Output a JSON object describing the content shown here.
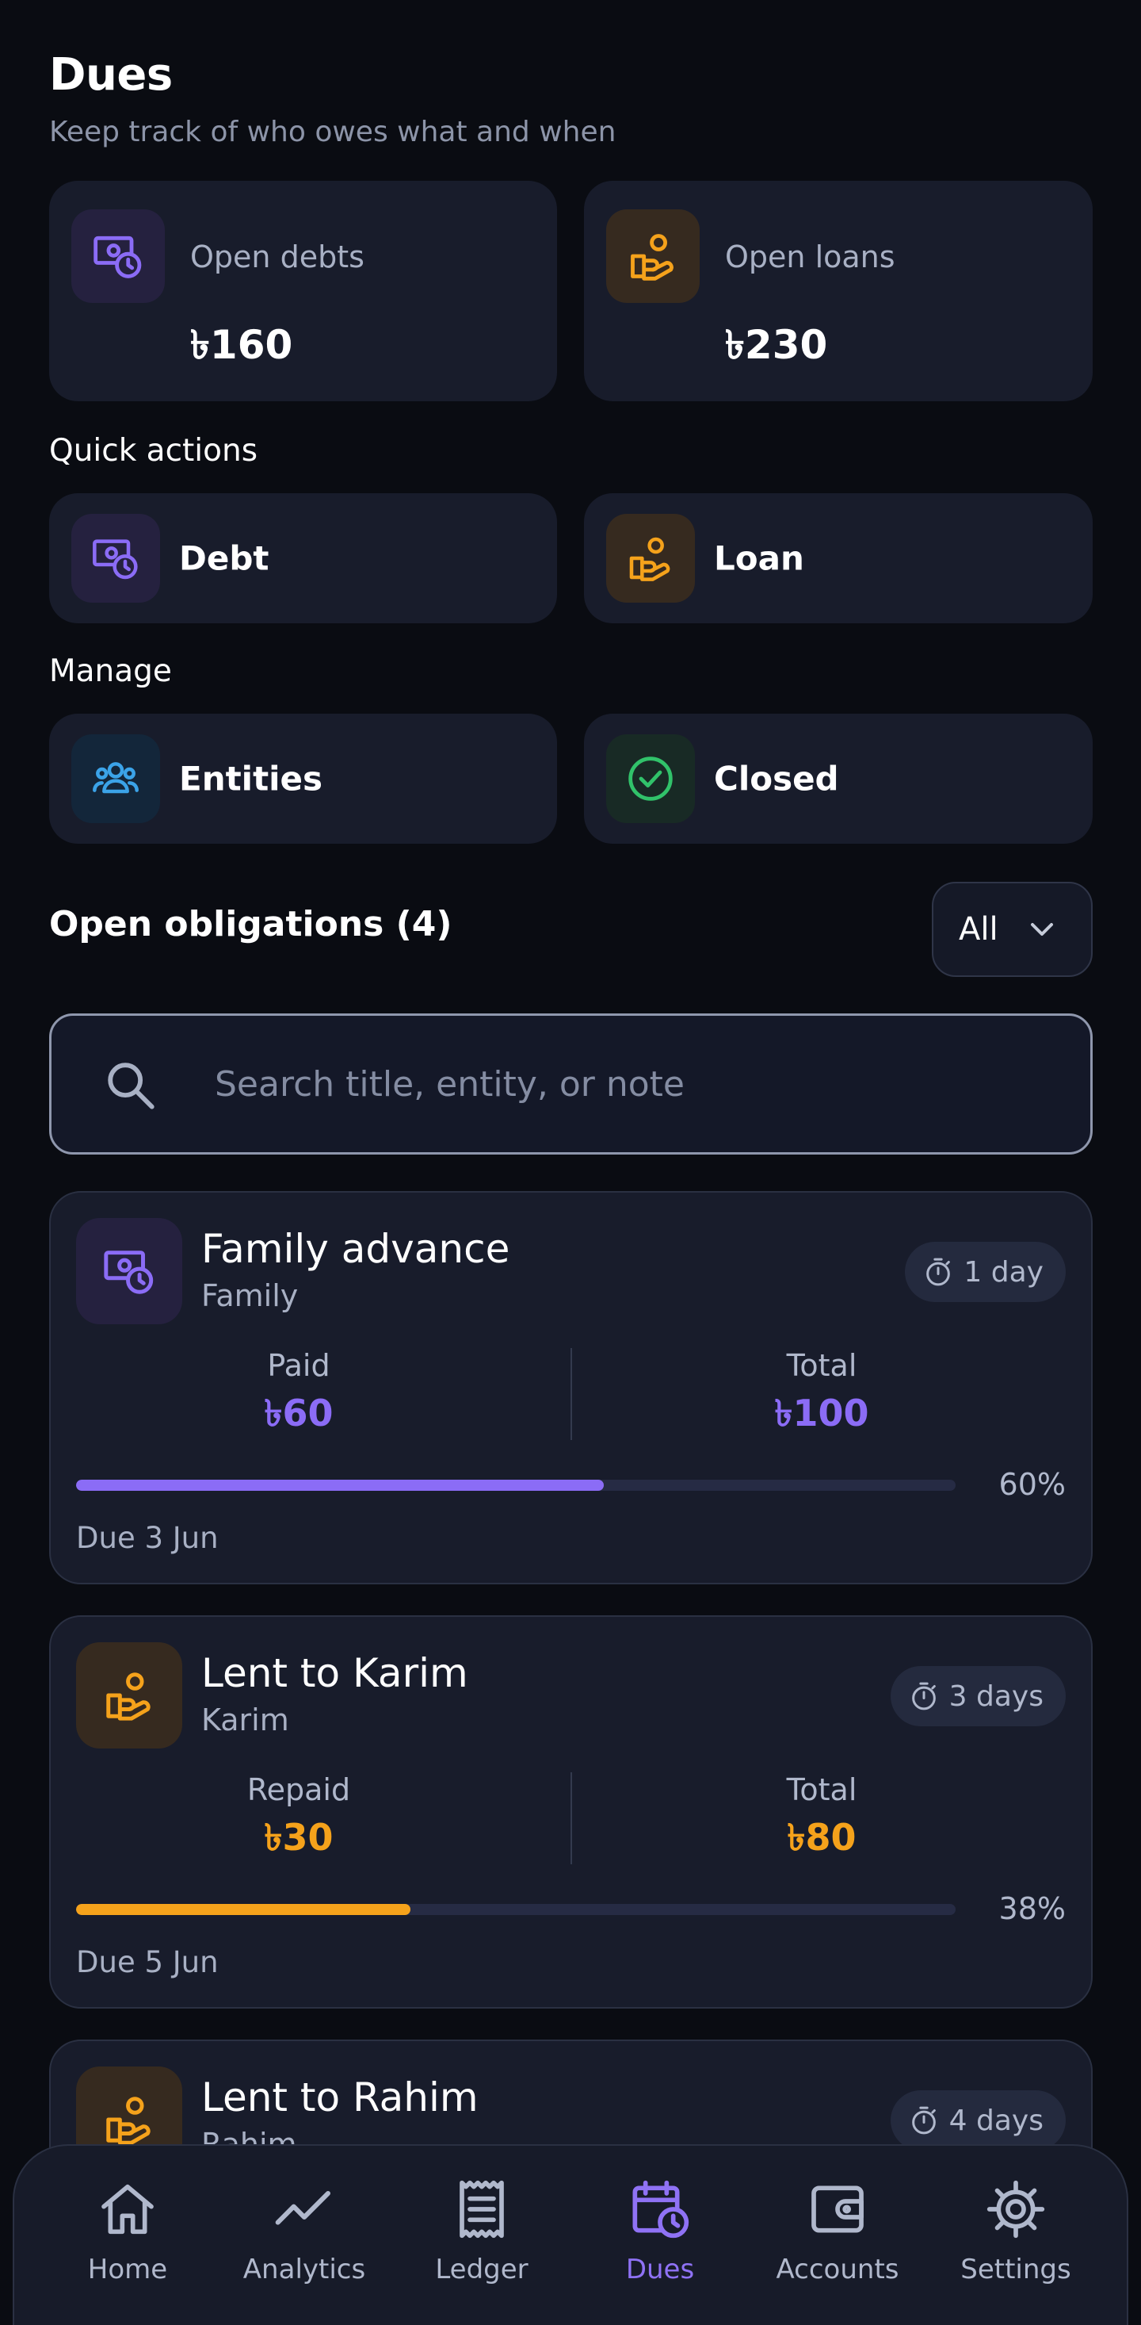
{
  "header": {
    "title": "Dues",
    "subtitle": "Keep track of who owes what and when"
  },
  "summary": {
    "debts": {
      "label": "Open debts",
      "value": "৳160",
      "icon": "debt-icon"
    },
    "loans": {
      "label": "Open loans",
      "value": "৳230",
      "icon": "loan-icon"
    }
  },
  "quick_actions": {
    "heading": "Quick actions",
    "debt_label": "Debt",
    "loan_label": "Loan"
  },
  "manage": {
    "heading": "Manage",
    "entities_label": "Entities",
    "closed_label": "Closed"
  },
  "obligations": {
    "heading": "Open obligations (4)",
    "filter_value": "All",
    "search_placeholder": "Search title, entity, or note",
    "items": [
      {
        "title": "Family advance",
        "entity": "Family",
        "badge": "1 day",
        "paid_label": "Paid",
        "paid_value": "৳60",
        "total_label": "Total",
        "total_value": "৳100",
        "progress": 0.6,
        "progress_text": "60%",
        "due": "Due 3 Jun",
        "kind": "debt",
        "accent": "#8b6cf6"
      },
      {
        "title": "Lent to Karim",
        "entity": "Karim",
        "badge": "3 days",
        "paid_label": "Repaid",
        "paid_value": "৳30",
        "total_label": "Total",
        "total_value": "৳80",
        "progress": 0.38,
        "progress_text": "38%",
        "due": "Due 5 Jun",
        "kind": "loan",
        "accent": "#f5a21b"
      },
      {
        "title": "Lent to Rahim",
        "entity": "Rahim",
        "badge": "4 days",
        "kind": "loan",
        "accent": "#f5a21b"
      }
    ]
  },
  "nav": {
    "items": [
      {
        "label": "Home",
        "icon": "home-icon"
      },
      {
        "label": "Analytics",
        "icon": "analytics-icon"
      },
      {
        "label": "Ledger",
        "icon": "ledger-icon"
      },
      {
        "label": "Dues",
        "icon": "dues-icon",
        "active": true
      },
      {
        "label": "Accounts",
        "icon": "accounts-icon"
      },
      {
        "label": "Settings",
        "icon": "settings-icon"
      }
    ]
  },
  "colors": {
    "debt_accent": "#8b6cf6",
    "loan_accent": "#f5a21b",
    "entities_accent": "#3ba3e8",
    "closed_accent": "#31c26a",
    "background": "#0a0c12",
    "card": "#181c2b"
  }
}
